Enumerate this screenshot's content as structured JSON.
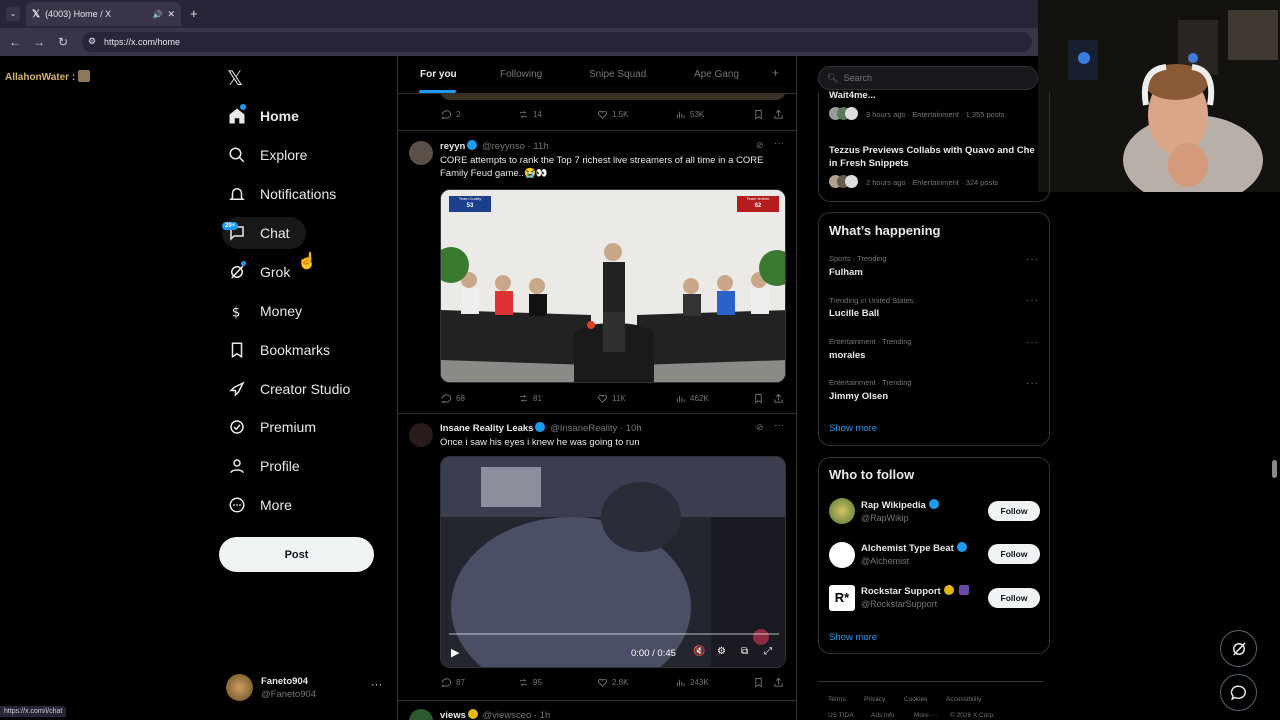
{
  "browser": {
    "tab_title": "(4003) Home / X",
    "url": "https://x.com/home",
    "status_url": "https://x.com/i/chat"
  },
  "overlay": {
    "stream_name": "AllahonWater :"
  },
  "sidebar": {
    "items": [
      {
        "label": "Home",
        "icon": "home-icon"
      },
      {
        "label": "Explore",
        "icon": "search-icon"
      },
      {
        "label": "Notifications",
        "icon": "bell-icon"
      },
      {
        "label": "Chat",
        "icon": "chat-icon"
      },
      {
        "label": "Grok",
        "icon": "grok-icon"
      },
      {
        "label": "Money",
        "icon": "money-icon"
      },
      {
        "label": "Bookmarks",
        "icon": "bookmark-icon"
      },
      {
        "label": "Creator Studio",
        "icon": "rocket-icon"
      },
      {
        "label": "Premium",
        "icon": "premium-icon"
      },
      {
        "label": "Profile",
        "icon": "person-icon"
      },
      {
        "label": "More",
        "icon": "more-icon"
      }
    ],
    "chat_badge": "20+",
    "post_label": "Post",
    "profile": {
      "name": "Faneto904",
      "handle": "@Faneto904"
    }
  },
  "feed": {
    "tabs": [
      "For you",
      "Following",
      "Snipe Squad",
      "Ape Gang"
    ],
    "prev_actions": {
      "replies": "2",
      "reposts": "14",
      "likes": "1.5K",
      "views": "53K"
    },
    "tweets": [
      {
        "name": "reyyn",
        "handle": "@reyynso",
        "time": "11h",
        "text": "CORE attempts to rank the Top 7 richest live streamers of all time in a CORE Family Feud game..😭👀",
        "score_left_team": "Team Cuddy",
        "score_left": "53",
        "score_right_team": "Team Nother",
        "score_right": "62",
        "replies": "68",
        "reposts": "81",
        "likes": "11K",
        "views": "462K"
      },
      {
        "name": "Insane Reality Leaks",
        "handle": "@InsaneReality",
        "time": "10h",
        "text": "Once i saw his eyes i knew he was going to run",
        "video_time": "0:00 / 0:45",
        "replies": "87",
        "reposts": "95",
        "likes": "2.8K",
        "views": "243K"
      },
      {
        "name": "views",
        "handle": "@viewsceo",
        "time": "1h"
      }
    ]
  },
  "right": {
    "search_placeholder": "Search",
    "news": [
      {
        "title": "Wait4me...",
        "meta": "3 hours ago · Entertainment · 1,355 posts"
      },
      {
        "title": "Tezzus Previews Collabs with Quavo and Che in Fresh Snippets",
        "meta": "2 hours ago · Entertainment · 324 posts"
      }
    ],
    "happening_title": "What’s happening",
    "trends": [
      {
        "meta": "Sports · Trending",
        "name": "Fulham"
      },
      {
        "meta": "Trending in United States",
        "name": "Lucille Ball"
      },
      {
        "meta": "Entertainment · Trending",
        "name": "morales"
      },
      {
        "meta": "Entertainment · Trending",
        "name": "Jimmy Olsen"
      }
    ],
    "show_more": "Show more",
    "wtf_title": "Who to follow",
    "follows": [
      {
        "name": "Rap Wikipedia",
        "handle": "@RapWikip",
        "color": "#6b8f3a"
      },
      {
        "name": "Alchemist Type Beat",
        "handle": "@Alchemist",
        "color": "#ffffff"
      },
      {
        "name": "Rockstar Support",
        "handle": "@RockstarSupport",
        "color": "#ffffff"
      }
    ],
    "follow_label": "Follow",
    "footer": [
      "Terms",
      "Privacy",
      "Cookies",
      "Accessibility",
      "US TIDA",
      "Ads info",
      "More ···",
      "© 2026 X Corp."
    ]
  },
  "colors": {
    "accent": "#1d9bf0",
    "background": "#000000",
    "border": "#2f3336"
  }
}
